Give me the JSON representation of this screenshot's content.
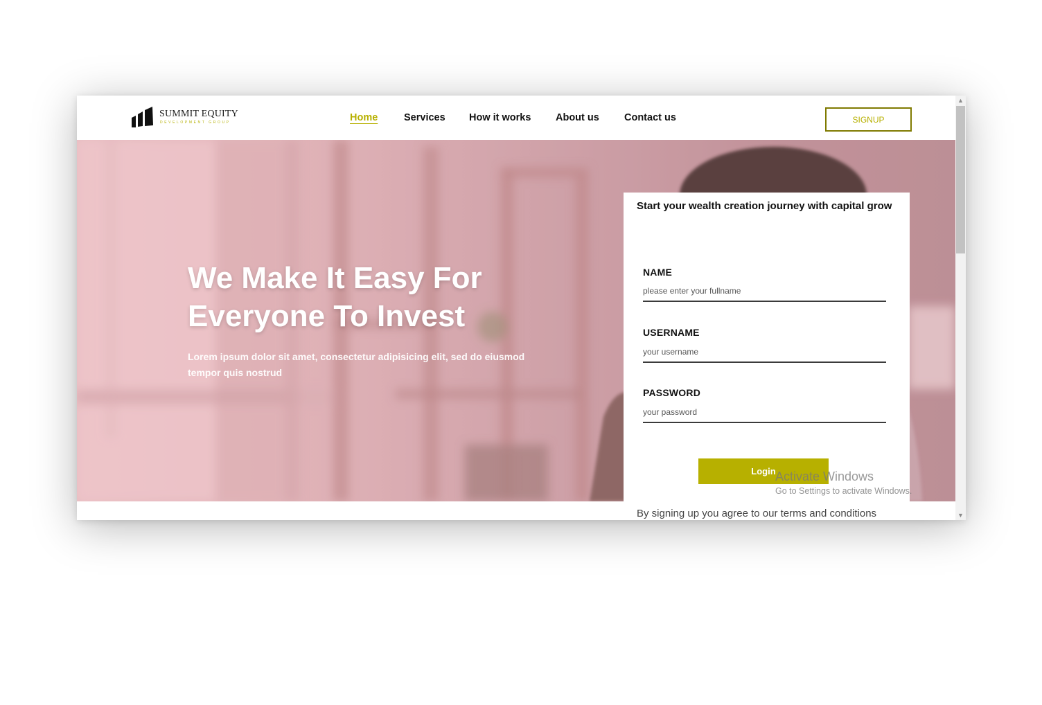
{
  "brand": {
    "name": "SUMMIT EQUITY",
    "subtitle": "DEVELOPMENT GROUP",
    "accent": "#b7b000"
  },
  "nav": [
    {
      "label": "Home",
      "active": true
    },
    {
      "label": "Services",
      "active": false
    },
    {
      "label": "How it works",
      "active": false
    },
    {
      "label": "About us",
      "active": false
    },
    {
      "label": "Contact us",
      "active": false
    }
  ],
  "header": {
    "signup_label": "SIGNUP"
  },
  "hero": {
    "title": "We Make It Easy For Everyone To Invest",
    "subtitle": "Lorem ipsum dolor sit amet, consectetur adipisicing elit, sed do eiusmod tempor quis nostrud"
  },
  "form": {
    "title": "Start your wealth creation journey with capital grow",
    "fields": [
      {
        "label": "NAME",
        "placeholder": "please enter your fullname",
        "value": ""
      },
      {
        "label": "USERNAME",
        "placeholder": "your username",
        "value": ""
      },
      {
        "label": "PASSWORD",
        "placeholder": "your password",
        "value": ""
      }
    ],
    "login_label": "Login",
    "terms": "By signing up you agree to our terms and conditions"
  },
  "watermark": {
    "title": "Activate Windows",
    "subtitle": "Go to Settings to activate Windows."
  },
  "scrollbar": {
    "up_icon": "chevron-up-icon",
    "down_icon": "chevron-down-icon"
  }
}
